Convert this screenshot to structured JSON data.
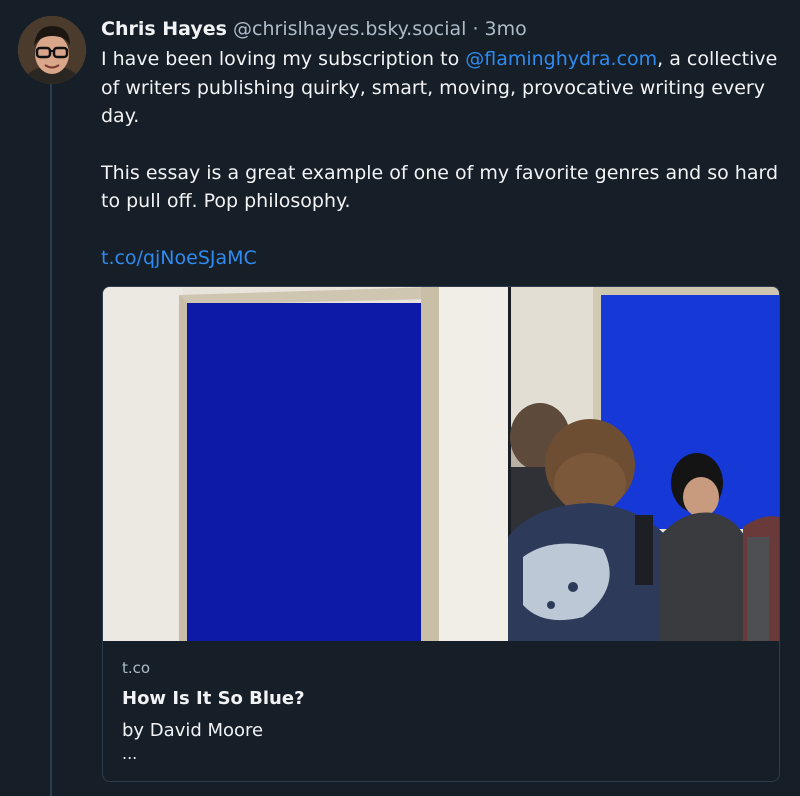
{
  "post": {
    "author": "Chris Hayes",
    "handle": "@chrislhayes.bsky.social",
    "separator": "·",
    "age": "3mo",
    "text_before_mention": "I have been loving my subscription to ",
    "mention": "@flaminghydra.com",
    "text_after_mention": ", a collective of writers publishing quirky, smart, moving, provocative writing every day.",
    "paragraph2": "This essay is a great example of one of my favorite genres and so hard to pull off. Pop philosophy.",
    "link": "t.co/qjNoeSJaMC"
  },
  "card": {
    "domain": "t.co",
    "title": "How Is It So Blue?",
    "description": "by David Moore",
    "more": "..."
  },
  "colors": {
    "background": "#161e27",
    "link": "#2f8bf0",
    "muted": "#aebbc9",
    "border": "#2e3d4d",
    "klein_blue": "#0b1ea0"
  }
}
